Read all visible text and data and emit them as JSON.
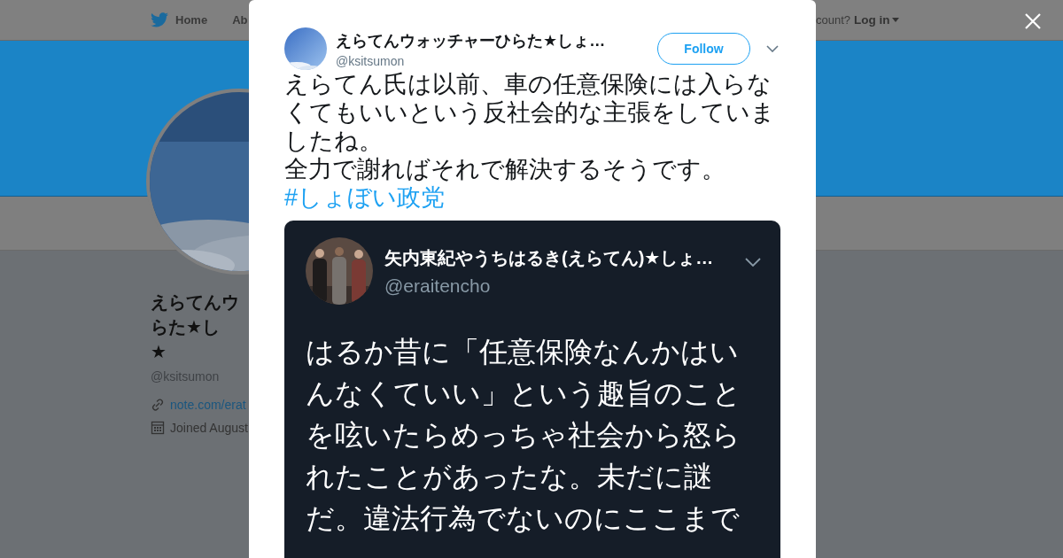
{
  "nav": {
    "items": [
      {
        "label": "Home"
      },
      {
        "label": "Ab"
      }
    ],
    "account_prompt": "count?",
    "login": "Log in"
  },
  "profile": {
    "name_lines": [
      "えらてんウ",
      "らた★し",
      "★"
    ],
    "handle": "@ksitsumon",
    "link": "note.com/erat",
    "joined": "Joined August"
  },
  "modal": {
    "author": {
      "name": "えらてんウォッチャーひらた★しょ…",
      "handle": "@ksitsumon"
    },
    "follow": "Follow",
    "paragraphs": [
      "えらてん氏は以前、車の任意保険には入らなくてもいいという反社会的な主張をしていましたね。",
      "全力で謝ればそれで解決するそうです。"
    ],
    "hashtag": "#しょぼい政党",
    "embedded": {
      "author": {
        "name": "矢内東紀やうちはるき(えらてん)★しょ…",
        "handle": "@eraitencho"
      },
      "text": "はるか昔に「任意保険なんかはいんなくていい」という趣旨のことを呟いたらめっちゃ社会から怒られたことがあったな。未だに謎だ。違法行為でないのにここまで"
    }
  }
}
